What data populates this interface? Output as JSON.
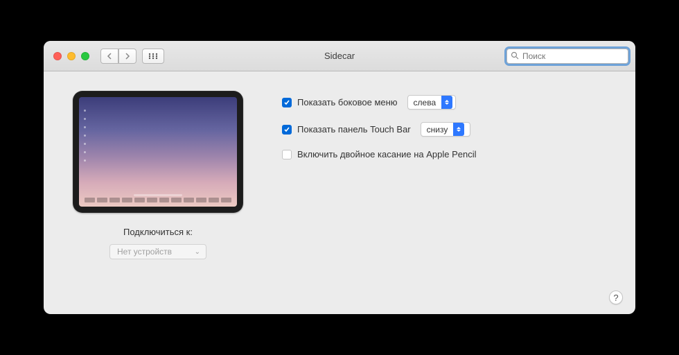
{
  "window": {
    "title": "Sidecar",
    "search_placeholder": "Поиск"
  },
  "left": {
    "connect_label": "Подключиться к:",
    "device_select": "Нет устройств"
  },
  "options": {
    "sidebar": {
      "checked": true,
      "label": "Показать боковое меню",
      "value": "слева"
    },
    "touchbar": {
      "checked": true,
      "label": "Показать панель Touch Bar",
      "value": "снизу"
    },
    "doubletap": {
      "checked": false,
      "label": "Включить двойное касание на Apple Pencil"
    }
  },
  "help": "?"
}
